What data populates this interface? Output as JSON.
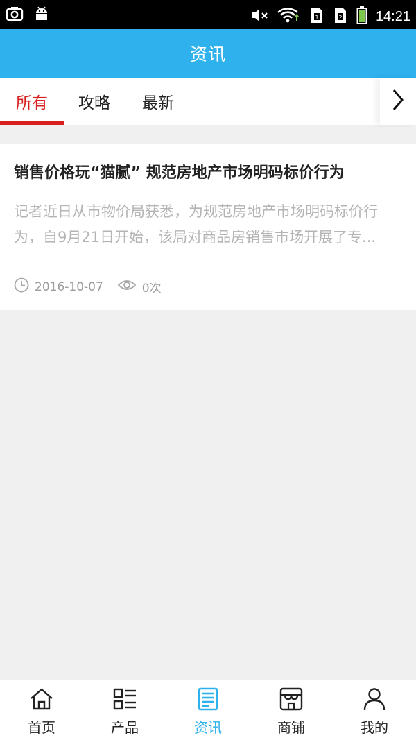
{
  "status_bar": {
    "time": "14:21",
    "icons": [
      "screenshot-icon",
      "android-icon",
      "mute-icon",
      "wifi-icon",
      "sim1-icon",
      "sim2-icon",
      "battery-icon"
    ]
  },
  "header": {
    "title": "资讯",
    "color": "#2eb1ec"
  },
  "tabs": {
    "items": [
      {
        "label": "所有",
        "active": true
      },
      {
        "label": "攻略",
        "active": false
      },
      {
        "label": "最新",
        "active": false
      }
    ],
    "active_color": "#d81e1e",
    "more_icon": "chevron-right-icon"
  },
  "articles": [
    {
      "title": "销售价格玩“猫腻” 规范房地产市场明码标价行为",
      "summary": "记者近日从市物价局获悉，为规范房地产市场明码标价行为，自9月21日开始，该局对商品房销售市场开展了专...",
      "date": "2016-10-07",
      "views": "0次"
    }
  ],
  "bottom_nav": {
    "items": [
      {
        "label": "首页",
        "icon": "home-icon",
        "active": false
      },
      {
        "label": "产品",
        "icon": "list-icon",
        "active": false
      },
      {
        "label": "资讯",
        "icon": "news-icon",
        "active": true
      },
      {
        "label": "商铺",
        "icon": "store-icon",
        "active": false
      },
      {
        "label": "我的",
        "icon": "user-icon",
        "active": false
      }
    ],
    "active_color": "#2eb1ec"
  }
}
